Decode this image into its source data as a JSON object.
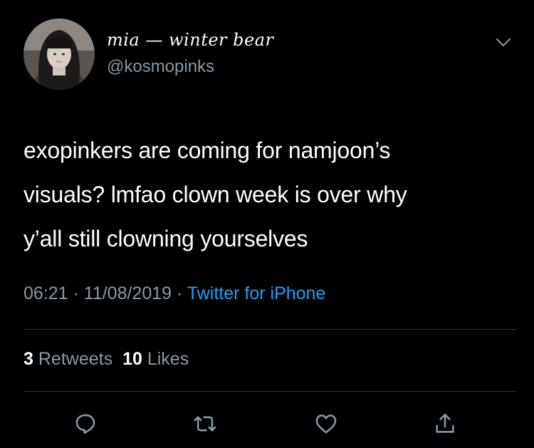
{
  "tweet": {
    "display_name_left": "mia",
    "display_name_dash": " — ",
    "display_name_right": "winter bear",
    "handle": "@kosmopinks",
    "text_lines": [
      "exopinkers are coming for namjoon’s",
      "visuals? lmfao clown week is over why",
      "y’all still clowning yourselves"
    ],
    "time": "06:21",
    "date": "11/08/2019",
    "separator": " · ",
    "source": "Twitter for iPhone"
  },
  "stats": {
    "retweets_count": "3",
    "retweets_label": "Retweets",
    "likes_count": "10",
    "likes_label": "Likes"
  },
  "icons": {
    "more": "chevron-down-icon",
    "reply": "reply-icon",
    "retweet": "retweet-icon",
    "like": "heart-icon",
    "share": "share-icon"
  },
  "colors": {
    "background": "#000000",
    "text": "#ffffff",
    "secondary": "#8899a6",
    "link": "#1da1f2",
    "divider": "#2f3336"
  }
}
